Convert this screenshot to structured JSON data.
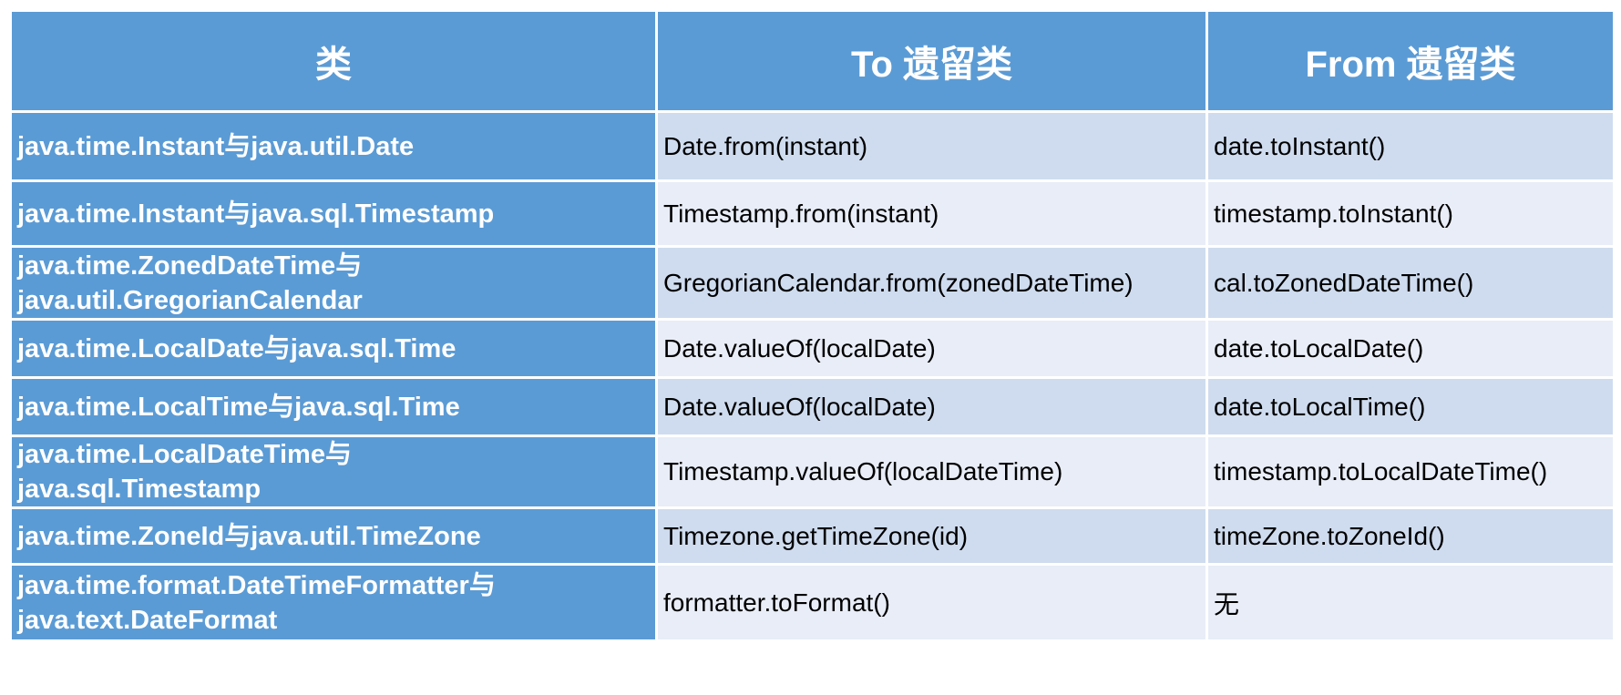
{
  "header": {
    "col_class": "类",
    "col_to": "To 遗留类",
    "col_from": "From 遗留类"
  },
  "rows": [
    {
      "class_lines": [
        "java.time.Instant与java.util.Date"
      ],
      "to": "Date.from(instant)",
      "from": "date.toInstant()"
    },
    {
      "class_lines": [
        "java.time.Instant与java.sql.Timestamp"
      ],
      "to": "Timestamp.from(instant)",
      "from": "timestamp.toInstant()"
    },
    {
      "class_lines": [
        "java.time.ZonedDateTime与",
        "java.util.GregorianCalendar"
      ],
      "to": "GregorianCalendar.from(zonedDateTime)",
      "from": "cal.toZonedDateTime()"
    },
    {
      "class_lines": [
        "java.time.LocalDate与java.sql.Time"
      ],
      "to": "Date.valueOf(localDate)",
      "from": "date.toLocalDate()"
    },
    {
      "class_lines": [
        "java.time.LocalTime与java.sql.Time"
      ],
      "to": "Date.valueOf(localDate)",
      "from": "date.toLocalTime()"
    },
    {
      "class_lines": [
        "java.time.LocalDateTime与",
        "java.sql.Timestamp"
      ],
      "to": "Timestamp.valueOf(localDateTime)",
      "from": "timestamp.toLocalDateTime()"
    },
    {
      "class_lines": [
        "java.time.ZoneId与java.util.TimeZone"
      ],
      "to": "Timezone.getTimeZone(id)",
      "from": "timeZone.toZoneId()"
    },
    {
      "class_lines": [
        "java.time.format.DateTimeFormatter与",
        "java.text.DateFormat"
      ],
      "to": "formatter.toFormat()",
      "from": "无"
    }
  ],
  "colors": {
    "header_bg": "#5b9bd5",
    "key_col_bg": "#5b9bd5",
    "row_dark_bg": "#cfdcef",
    "row_light_bg": "#e8edf7",
    "border": "#ffffff"
  }
}
